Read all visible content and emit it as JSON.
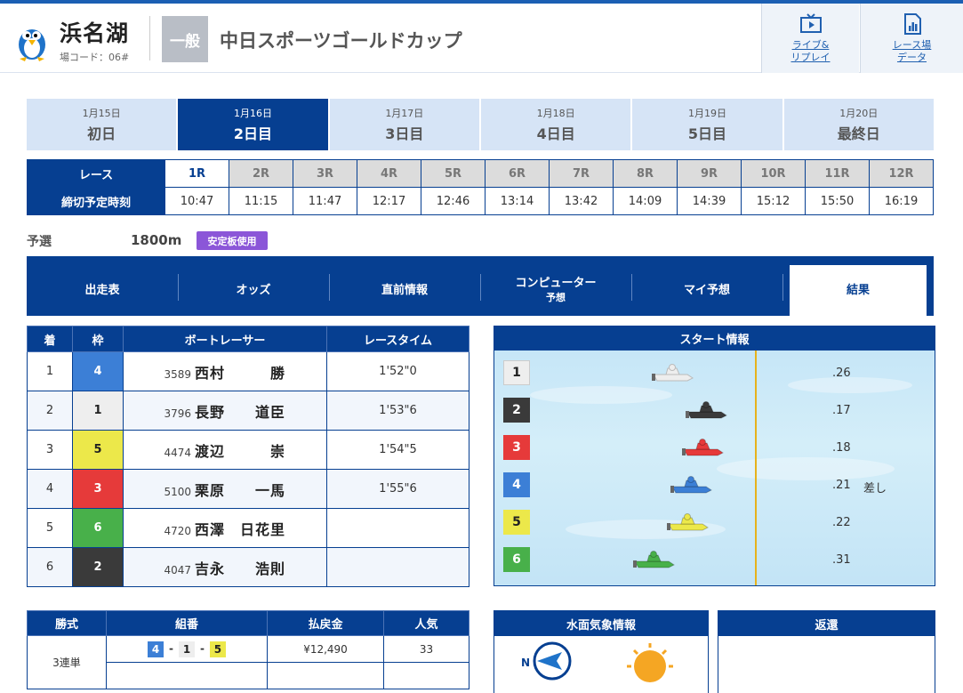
{
  "header": {
    "venue_name": "浜名湖",
    "venue_code": "場コード：06#",
    "grade": "一般",
    "race_title": "中日スポーツゴールドカップ",
    "live_label_1": "ライブ&",
    "live_label_2": "リプレイ",
    "data_label_1": "レース場",
    "data_label_2": "データ"
  },
  "days": [
    {
      "date": "1月15日",
      "name": "初日"
    },
    {
      "date": "1月16日",
      "name": "2日目"
    },
    {
      "date": "1月17日",
      "name": "3日目"
    },
    {
      "date": "1月18日",
      "name": "4日目"
    },
    {
      "date": "1月19日",
      "name": "5日目"
    },
    {
      "date": "1月20日",
      "name": "最終日"
    }
  ],
  "active_day": 1,
  "races": {
    "race_label": "レース",
    "time_label": "締切予定時刻",
    "numbers": [
      "1R",
      "2R",
      "3R",
      "4R",
      "5R",
      "6R",
      "7R",
      "8R",
      "9R",
      "10R",
      "11R",
      "12R"
    ],
    "times": [
      "10:47",
      "11:15",
      "11:47",
      "12:17",
      "12:46",
      "13:14",
      "13:42",
      "14:09",
      "14:39",
      "15:12",
      "15:50",
      "16:19"
    ]
  },
  "race_info": {
    "type": "予選",
    "distance": "1800m",
    "badge": "安定板使用"
  },
  "tabs": {
    "t1": "出走表",
    "t2": "オッズ",
    "t3": "直前情報",
    "t4a": "コンピューター",
    "t4b": "予想",
    "t5": "マイ予想",
    "t6": "結果"
  },
  "result": {
    "headers": {
      "rank": "着",
      "waku": "枠",
      "racer": "ボートレーサー",
      "time": "レースタイム"
    },
    "rows": [
      {
        "rank": "1",
        "waku": "4",
        "reg": "3589",
        "name": "西村　　　勝",
        "time": "1'52\"0"
      },
      {
        "rank": "2",
        "waku": "1",
        "reg": "3796",
        "name": "長野　　道臣",
        "time": "1'53\"6"
      },
      {
        "rank": "3",
        "waku": "5",
        "reg": "4474",
        "name": "渡辺　　　崇",
        "time": "1'54\"5"
      },
      {
        "rank": "4",
        "waku": "3",
        "reg": "5100",
        "name": "栗原　　一馬",
        "time": "1'55\"6"
      },
      {
        "rank": "5",
        "waku": "6",
        "reg": "4720",
        "name": "西澤　日花里",
        "time": ""
      },
      {
        "rank": "6",
        "waku": "2",
        "reg": "4047",
        "name": "吉永　　浩則",
        "time": ""
      }
    ]
  },
  "start": {
    "title": "スタート情報",
    "rows": [
      {
        "course": "1",
        "st": ".26",
        "kimarite": ""
      },
      {
        "course": "2",
        "st": ".17",
        "kimarite": ""
      },
      {
        "course": "3",
        "st": ".18",
        "kimarite": ""
      },
      {
        "course": "4",
        "st": ".21",
        "kimarite": "差し"
      },
      {
        "course": "5",
        "st": ".22",
        "kimarite": ""
      },
      {
        "course": "6",
        "st": ".31",
        "kimarite": ""
      }
    ]
  },
  "payout": {
    "headers": {
      "bet": "勝式",
      "combo": "組番",
      "amount": "払戻金",
      "pop": "人気"
    },
    "rows": [
      {
        "bet": "3連単",
        "c1": "4",
        "c2": "1",
        "c3": "5",
        "amount": "¥12,490",
        "pop": "33"
      }
    ]
  },
  "weather": {
    "title": "水面気象情報",
    "compass": "N"
  },
  "henkan": {
    "title": "返還"
  },
  "colors": {
    "navy": "#063f91",
    "waku": {
      "1": "#eeeeee",
      "2": "#3a3a3a",
      "3": "#e63a3a",
      "4": "#3c7fd6",
      "5": "#ece84a",
      "6": "#48b04a"
    }
  }
}
